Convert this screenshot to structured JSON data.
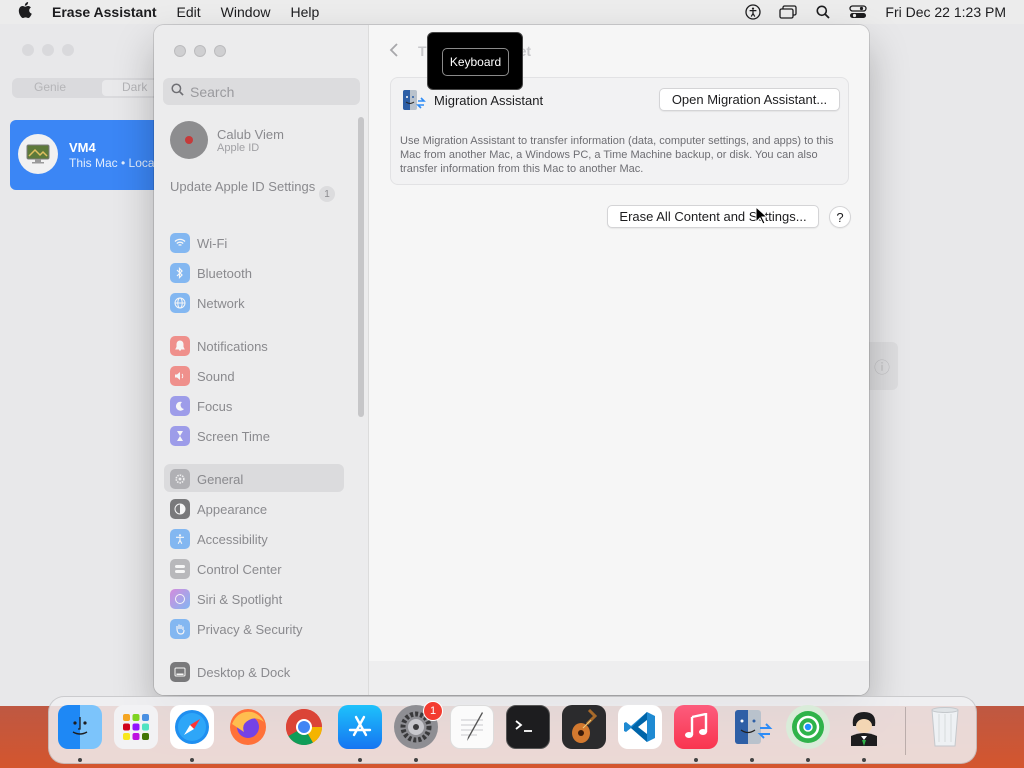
{
  "menubar": {
    "app_name": "Erase Assistant",
    "menus": [
      "Edit",
      "Window",
      "Help"
    ],
    "clock": "Fri Dec 22  1:23 PM",
    "icons": [
      "apple-icon",
      "accessibility-icon",
      "screen-mirroring-icon",
      "spotlight-search-icon",
      "control-center-icon"
    ]
  },
  "background_window": {
    "segments": [
      "Genie",
      "Dark"
    ],
    "vm_card": {
      "title": "VM4",
      "subtitle": "This Mac • Local"
    }
  },
  "sidebar": {
    "search_placeholder": "Search",
    "profile": {
      "name": "Calub Viem",
      "sub": "Apple ID"
    },
    "update": {
      "label": "Update Apple ID Settings",
      "badge": "1"
    },
    "items": [
      {
        "label": "Wi-Fi",
        "icon": "wifi-icon",
        "color": "#2e8cf6"
      },
      {
        "label": "Bluetooth",
        "icon": "bluetooth-icon",
        "color": "#2e8cf6"
      },
      {
        "label": "Network",
        "icon": "globe-icon",
        "color": "#2e8cf6"
      },
      {
        "label": "Notifications",
        "icon": "bell-icon",
        "color": "#f2453d"
      },
      {
        "label": "Sound",
        "icon": "speaker-icon",
        "color": "#f2453d"
      },
      {
        "label": "Focus",
        "icon": "moon-icon",
        "color": "#5e5ce6"
      },
      {
        "label": "Screen Time",
        "icon": "hourglass-icon",
        "color": "#5e5ce6"
      },
      {
        "label": "General",
        "icon": "gear-icon",
        "color": "#8e8e93",
        "selected": true
      },
      {
        "label": "Appearance",
        "icon": "appearance-icon",
        "color": "#1d1d1f"
      },
      {
        "label": "Accessibility",
        "icon": "accessibility-icon",
        "color": "#2e8cf6"
      },
      {
        "label": "Control Center",
        "icon": "control-center-icon",
        "color": "#8e8e93"
      },
      {
        "label": "Siri & Spotlight",
        "icon": "siri-icon",
        "color": "#c23ecf"
      },
      {
        "label": "Privacy & Security",
        "icon": "hand-icon",
        "color": "#2e8cf6"
      },
      {
        "label": "Desktop & Dock",
        "icon": "dock-icon",
        "color": "#1d1d1f"
      }
    ]
  },
  "content": {
    "title_visible_left": "T",
    "title_visible_right": "et",
    "migration": {
      "title": "Migration Assistant",
      "button": "Open Migration Assistant...",
      "description": "Use Migration Assistant to transfer information (data, computer settings, and apps) to this Mac from another Mac, a Windows PC, a Time Machine backup, or disk. You can also transfer information from this Mac to another Mac."
    },
    "erase_button": "Erase All Content and Settings...",
    "help_button": "?"
  },
  "keyboard_popup": {
    "label": "Keyboard"
  },
  "dock": {
    "apps": [
      "Finder",
      "Launchpad",
      "Safari",
      "Firefox",
      "Chrome",
      "App Store",
      "System Settings",
      "TextEdit",
      "Terminal",
      "GarageBand",
      "VS Code",
      "Music",
      "Migration Assistant",
      "Find My",
      "Bartender",
      "Trash"
    ],
    "settings_badge": "1"
  }
}
